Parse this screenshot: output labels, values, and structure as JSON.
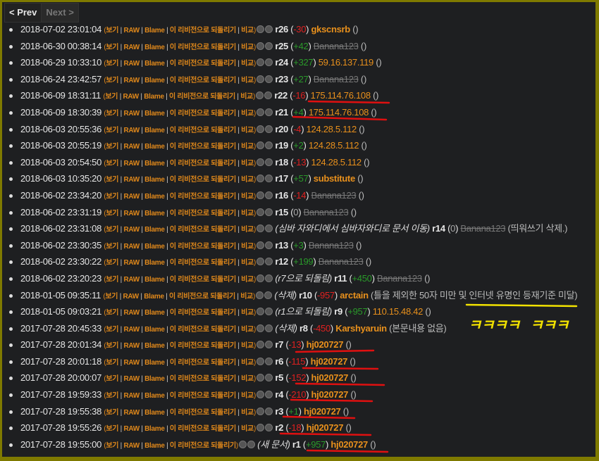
{
  "pager": {
    "prev": "< Prev",
    "next": "Next >"
  },
  "links": {
    "view": "보기",
    "raw": "RAW",
    "blame": "Blame",
    "revert": "이 리비전으로 되돌리기",
    "compare": "비교"
  },
  "annotation_handwriting": "ㅋㅋㅋㅋ ㅋㅋㅋ",
  "colors": {
    "frame": "#7f7a00",
    "background": "#1e1f21",
    "link": "#e0881a",
    "positive": "#2a9a2a",
    "negative": "#e02020",
    "underline_red": "#e01010",
    "underline_yellow": "#f2e200"
  },
  "revisions": [
    {
      "date": "2018-07-02 23:01:04",
      "compare": true,
      "note": "",
      "rev": "r26",
      "diff": "-30",
      "author": "gkscnsrb",
      "author_type": "user",
      "comment": ""
    },
    {
      "date": "2018-06-30 00:38:14",
      "compare": true,
      "note": "",
      "rev": "r25",
      "diff": "+42",
      "author": "Banana123",
      "author_type": "deleted",
      "comment": ""
    },
    {
      "date": "2018-06-29 10:33:10",
      "compare": true,
      "note": "",
      "rev": "r24",
      "diff": "+327",
      "author": "59.16.137.119",
      "author_type": "ip",
      "comment": ""
    },
    {
      "date": "2018-06-24 23:42:57",
      "compare": true,
      "note": "",
      "rev": "r23",
      "diff": "+27",
      "author": "Banana123",
      "author_type": "deleted",
      "comment": ""
    },
    {
      "date": "2018-06-09 18:31:11",
      "compare": true,
      "note": "",
      "rev": "r22",
      "diff": "-16",
      "author": "175.114.76.108",
      "author_type": "ip",
      "comment": ""
    },
    {
      "date": "2018-06-09 18:30:39",
      "compare": true,
      "note": "",
      "rev": "r21",
      "diff": "+4",
      "author": "175.114.76.108",
      "author_type": "ip",
      "comment": ""
    },
    {
      "date": "2018-06-03 20:55:36",
      "compare": true,
      "note": "",
      "rev": "r20",
      "diff": "-4",
      "author": "124.28.5.112",
      "author_type": "ip",
      "comment": ""
    },
    {
      "date": "2018-06-03 20:55:19",
      "compare": true,
      "note": "",
      "rev": "r19",
      "diff": "+2",
      "author": "124.28.5.112",
      "author_type": "ip",
      "comment": ""
    },
    {
      "date": "2018-06-03 20:54:50",
      "compare": true,
      "note": "",
      "rev": "r18",
      "diff": "-13",
      "author": "124.28.5.112",
      "author_type": "ip",
      "comment": ""
    },
    {
      "date": "2018-06-03 10:35:20",
      "compare": true,
      "note": "",
      "rev": "r17",
      "diff": "+57",
      "author": "substitute",
      "author_type": "user",
      "comment": ""
    },
    {
      "date": "2018-06-02 23:34:20",
      "compare": true,
      "note": "",
      "rev": "r16",
      "diff": "-14",
      "author": "Banana123",
      "author_type": "deleted",
      "comment": ""
    },
    {
      "date": "2018-06-02 23:31:19",
      "compare": true,
      "note": "",
      "rev": "r15",
      "diff": "0",
      "author": "Banana123",
      "author_type": "deleted",
      "comment": ""
    },
    {
      "date": "2018-06-02 23:31:08",
      "compare": true,
      "note": "(심바 자와디에서 심바자와디로 문서 이동)",
      "rev": "r14",
      "diff": "0",
      "author": "Banana123",
      "author_type": "deleted",
      "comment": "띄워쓰기 삭제."
    },
    {
      "date": "2018-06-02 23:30:35",
      "compare": true,
      "note": "",
      "rev": "r13",
      "diff": "+3",
      "author": "Banana123",
      "author_type": "deleted",
      "comment": ""
    },
    {
      "date": "2018-06-02 23:30:22",
      "compare": true,
      "note": "",
      "rev": "r12",
      "diff": "+199",
      "author": "Banana123",
      "author_type": "deleted",
      "comment": ""
    },
    {
      "date": "2018-06-02 23:20:23",
      "compare": true,
      "note": "(r7으로 되돌림)",
      "rev": "r11",
      "diff": "+450",
      "author": "Banana123",
      "author_type": "deleted",
      "comment": ""
    },
    {
      "date": "2018-01-05 09:35:11",
      "compare": true,
      "note": "(삭제)",
      "rev": "r10",
      "diff": "-957",
      "author": "arctain",
      "author_type": "user",
      "comment": "틀을 제외한 50자 미만 및 인터넷 유명인 등재기준 미달"
    },
    {
      "date": "2018-01-05 09:03:21",
      "compare": true,
      "note": "(r1으로 되돌림)",
      "rev": "r9",
      "diff": "+957",
      "author": "110.15.48.42",
      "author_type": "ip",
      "comment": ""
    },
    {
      "date": "2017-07-28 20:45:33",
      "compare": true,
      "note": "(삭제)",
      "rev": "r8",
      "diff": "-450",
      "author": "Karshyaruin",
      "author_type": "user",
      "comment": "본문내용 없음"
    },
    {
      "date": "2017-07-28 20:01:34",
      "compare": true,
      "note": "",
      "rev": "r7",
      "diff": "-13",
      "author": "hj020727",
      "author_type": "user",
      "comment": ""
    },
    {
      "date": "2017-07-28 20:01:18",
      "compare": true,
      "note": "",
      "rev": "r6",
      "diff": "-115",
      "author": "hj020727",
      "author_type": "user",
      "comment": ""
    },
    {
      "date": "2017-07-28 20:00:07",
      "compare": true,
      "note": "",
      "rev": "r5",
      "diff": "-152",
      "author": "hj020727",
      "author_type": "user",
      "comment": ""
    },
    {
      "date": "2017-07-28 19:59:33",
      "compare": true,
      "note": "",
      "rev": "r4",
      "diff": "-210",
      "author": "hj020727",
      "author_type": "user",
      "comment": ""
    },
    {
      "date": "2017-07-28 19:55:38",
      "compare": true,
      "note": "",
      "rev": "r3",
      "diff": "+1",
      "author": "hj020727",
      "author_type": "user",
      "comment": ""
    },
    {
      "date": "2017-07-28 19:55:26",
      "compare": true,
      "note": "",
      "rev": "r2",
      "diff": "-18",
      "author": "hj020727",
      "author_type": "user",
      "comment": ""
    },
    {
      "date": "2017-07-28 19:55:00",
      "compare": false,
      "note": "(새 문서)",
      "rev": "r1",
      "diff": "+957",
      "author": "hj020727",
      "author_type": "user",
      "comment": ""
    }
  ]
}
